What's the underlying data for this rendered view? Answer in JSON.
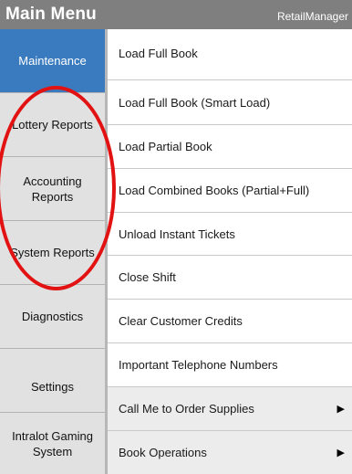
{
  "header": {
    "title": "Main Menu",
    "app_name": "RetailManager"
  },
  "sidebar": {
    "items": [
      {
        "label": "Maintenance",
        "active": true
      },
      {
        "label": "Lottery Reports"
      },
      {
        "label": "Accounting Reports"
      },
      {
        "label": "System Reports"
      },
      {
        "label": "Diagnostics"
      },
      {
        "label": "Settings"
      },
      {
        "label": "Intralot Gaming System"
      }
    ]
  },
  "menu": {
    "items": [
      {
        "label": "Load Full Book"
      },
      {
        "label": "Load Full Book (Smart Load)"
      },
      {
        "label": "Load Partial Book"
      },
      {
        "label": "Load Combined Books (Partial+Full)"
      },
      {
        "label": "Unload Instant Tickets"
      },
      {
        "label": "Close Shift"
      },
      {
        "label": "Clear Customer Credits"
      },
      {
        "label": "Important Telephone Numbers"
      },
      {
        "label": "Call Me to Order Supplies",
        "submenu": true
      },
      {
        "label": "Book Operations",
        "submenu": true
      }
    ]
  },
  "annotation": {
    "color": "#e31212"
  },
  "colors": {
    "accent": "#3a7bbf",
    "header": "#7f7f7f"
  }
}
